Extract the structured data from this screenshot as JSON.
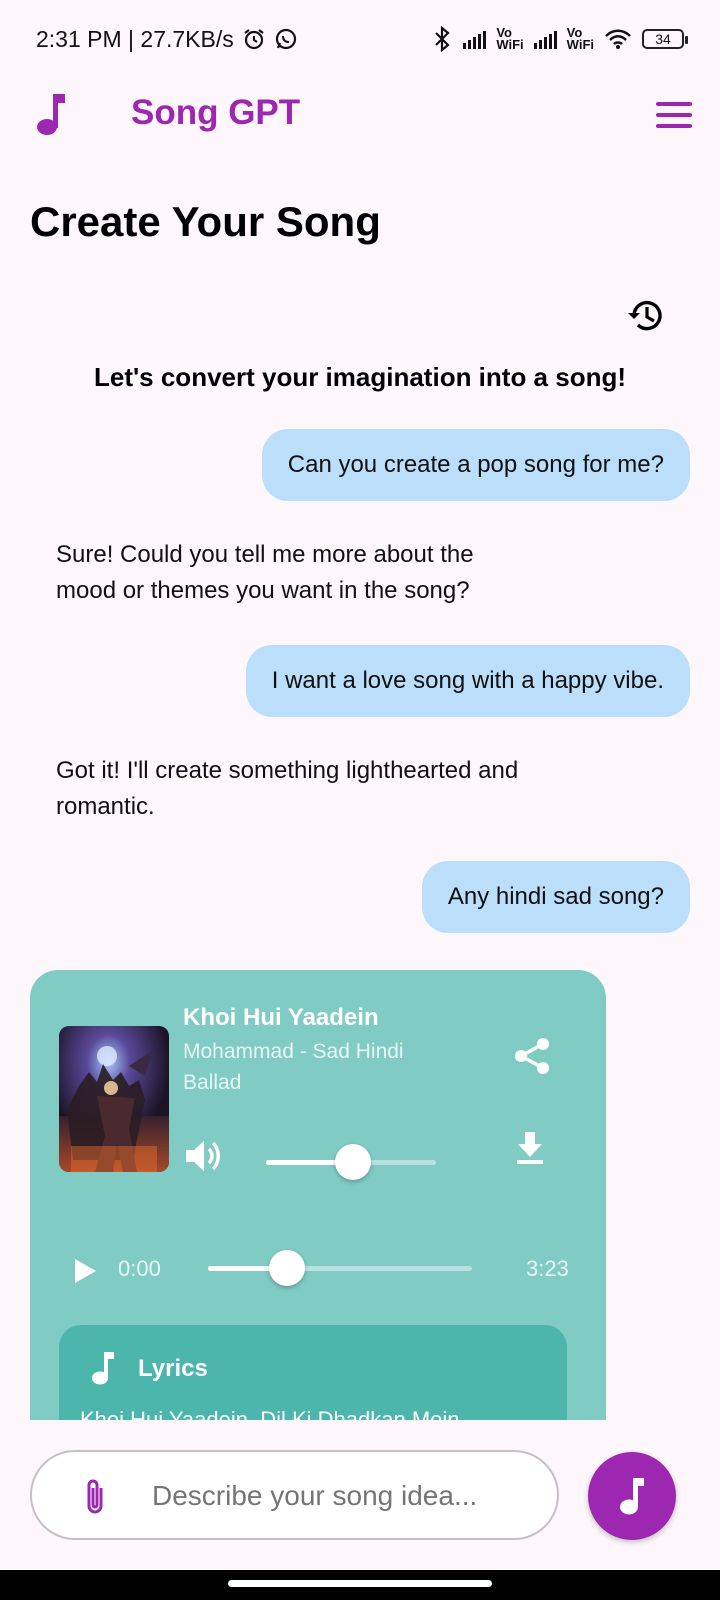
{
  "status_bar": {
    "time_speed": "2:31 PM | 27.7KB/s",
    "network_1": "Vo\nWiFi",
    "network_1_top": "Vo",
    "network_1_bottom": "WiFi",
    "network_2_top": "Vo",
    "network_2_bottom": "WiFi",
    "battery": "34"
  },
  "app_bar": {
    "title": "Song GPT",
    "logo_icon": "music-note-icon",
    "menu_icon": "hamburger-menu-icon",
    "accent_color": "#9c27b0"
  },
  "page": {
    "title": "Create Your Song",
    "history_icon": "history-icon",
    "intro": "Let's convert your imagination into a song!"
  },
  "chat": {
    "messages": [
      {
        "role": "user",
        "text": "Can you create a pop song for me?"
      },
      {
        "role": "bot",
        "text": "Sure! Could you tell me more about the mood or themes you want in the song?"
      },
      {
        "role": "user",
        "text": "I want a love song with a happy vibe."
      },
      {
        "role": "bot",
        "text": "Got it! I'll create something lighthearted and romantic."
      },
      {
        "role": "user",
        "text": "Any hindi sad song?"
      }
    ],
    "user_bubble_color": "#bbdefb"
  },
  "song_card": {
    "title": "Khoi Hui Yaadein",
    "artist": "Mohammad - Sad Hindi Ballad",
    "share_icon": "share-icon",
    "download_icon": "download-icon",
    "volume_icon": "volume-icon",
    "play_icon": "play-icon",
    "volume_level": 0.51,
    "current_time": "0:00",
    "total_time": "3:23",
    "progress_level": 0.3,
    "card_color": "#80cbc4",
    "lyrics": {
      "title": "Lyrics",
      "first_line": "Khoi Hui Yaadein, Dil Ki Dhadkan Mein",
      "icon": "music-note-icon",
      "color": "#4db6ac"
    }
  },
  "composer": {
    "placeholder": "Describe your song idea...",
    "attach_icon": "paperclip-icon",
    "send_icon": "music-note-icon"
  }
}
